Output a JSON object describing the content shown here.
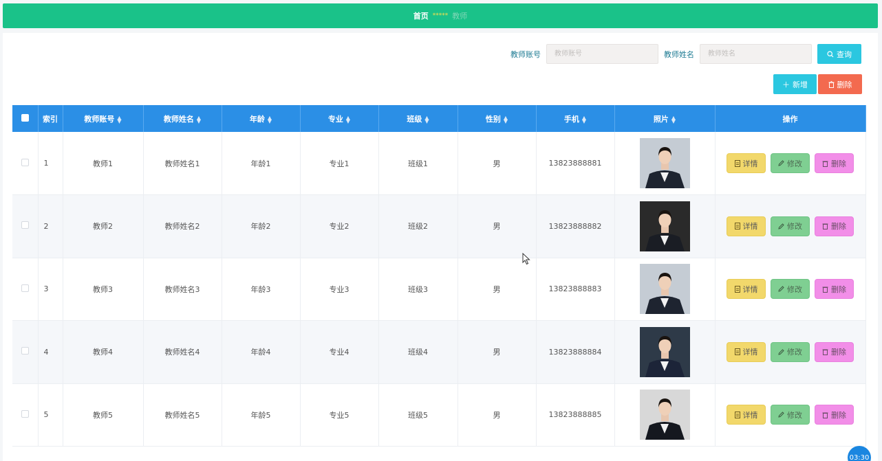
{
  "breadcrumb": {
    "home": "首页",
    "separator": "*****",
    "current": "教师"
  },
  "search": {
    "account_label": "教师账号",
    "account_placeholder": "教师账号",
    "name_label": "教师姓名",
    "name_placeholder": "教师姓名",
    "query_button": "查询",
    "query_icon": "search-icon"
  },
  "actions": {
    "add_label": "新增",
    "add_icon": "plus-icon",
    "delete_label": "删除",
    "delete_icon": "trash-icon"
  },
  "table": {
    "columns": [
      "索引",
      "教师账号",
      "教师姓名",
      "年龄",
      "专业",
      "班级",
      "性别",
      "手机",
      "照片",
      "操作"
    ],
    "rows": [
      {
        "index": "1",
        "account": "教师1",
        "name": "教师姓名1",
        "age": "年龄1",
        "major": "专业1",
        "class": "班级1",
        "gender": "男",
        "phone": "13823888881"
      },
      {
        "index": "2",
        "account": "教师2",
        "name": "教师姓名2",
        "age": "年龄2",
        "major": "专业2",
        "class": "班级2",
        "gender": "男",
        "phone": "13823888882"
      },
      {
        "index": "3",
        "account": "教师3",
        "name": "教师姓名3",
        "age": "年龄3",
        "major": "专业3",
        "class": "班级3",
        "gender": "男",
        "phone": "13823888883"
      },
      {
        "index": "4",
        "account": "教师4",
        "name": "教师姓名4",
        "age": "年龄4",
        "major": "专业4",
        "class": "班级4",
        "gender": "男",
        "phone": "13823888884"
      },
      {
        "index": "5",
        "account": "教师5",
        "name": "教师姓名5",
        "age": "年龄5",
        "major": "专业5",
        "class": "班级5",
        "gender": "男",
        "phone": "13823888885"
      }
    ],
    "row_actions": {
      "detail": "详情",
      "edit": "修改",
      "remove": "删除"
    }
  },
  "clock": "03:30",
  "colors": {
    "topbar": "#1ac289",
    "header": "#2b8fe6",
    "query": "#2bc7e0",
    "delete": "#f36a4f",
    "detail": "#f2d86b",
    "edit": "#7fcf92",
    "remove": "#f28ee8"
  }
}
